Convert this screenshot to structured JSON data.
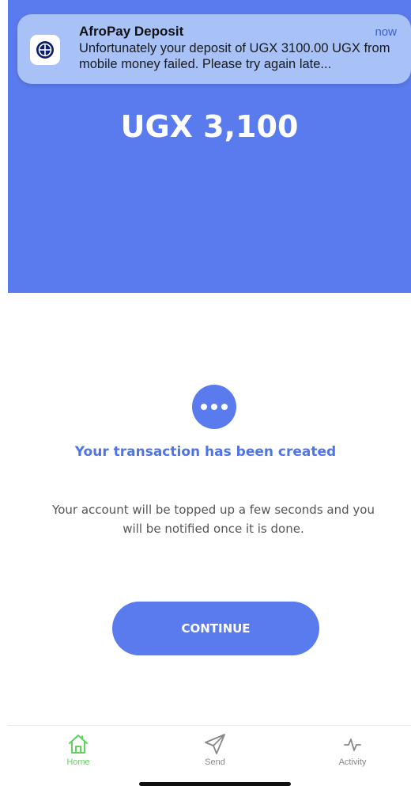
{
  "notification": {
    "app_name": "AfroPay Deposit",
    "time": "now",
    "message": "Unfortunately your deposit of UGX 3100.00 UGX from mobile money failed. Please try again late..."
  },
  "hero": {
    "amount": "UGX 3,100"
  },
  "status": {
    "icon": "more-dots-icon",
    "title": "Your transaction has been created",
    "description": "Your account will be topped up a few seconds and you will be notified once it is done."
  },
  "actions": {
    "continue_label": "CONTINUE"
  },
  "tabbar": {
    "items": [
      {
        "label": "Home",
        "icon": "home-icon",
        "active": true
      },
      {
        "label": "Send",
        "icon": "send-icon",
        "active": false
      },
      {
        "label": "Activity",
        "icon": "activity-icon",
        "active": false
      }
    ]
  },
  "colors": {
    "primary": "#5a7bed",
    "active_tab": "#5fd35c",
    "inactive_tab": "#888888"
  }
}
